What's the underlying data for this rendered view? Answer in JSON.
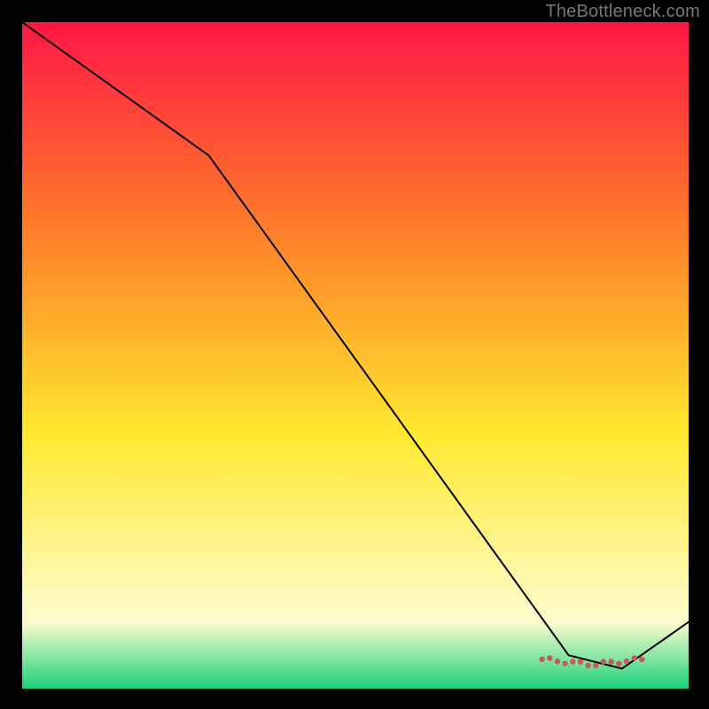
{
  "watermark": "TheBottleneck.com",
  "chart_data": {
    "type": "line",
    "title": "",
    "xlabel": "",
    "ylabel": "",
    "xlim": [
      0,
      100
    ],
    "ylim": [
      0,
      100
    ],
    "grid": false,
    "legend": false,
    "background_gradient": {
      "top_color": "#ff1745",
      "mid_color_1": "#ff7a2a",
      "mid_color_2": "#ffe92f",
      "lower_color": "#fdfccf",
      "bottom_color": "#1bd17b",
      "stops": [
        0.0,
        0.3,
        0.62,
        0.9,
        1.0
      ]
    },
    "series": [
      {
        "name": "curve",
        "color": "#000000",
        "width": 2,
        "data": [
          {
            "x": 0,
            "y": 100
          },
          {
            "x": 28,
            "y": 80
          },
          {
            "x": 82,
            "y": 5
          },
          {
            "x": 90,
            "y": 3
          },
          {
            "x": 100,
            "y": 10
          }
        ]
      }
    ],
    "dotted_segment": {
      "color": "#c95a5a",
      "y": 4,
      "x_start": 78,
      "x_end": 93,
      "dot_count": 14
    }
  }
}
